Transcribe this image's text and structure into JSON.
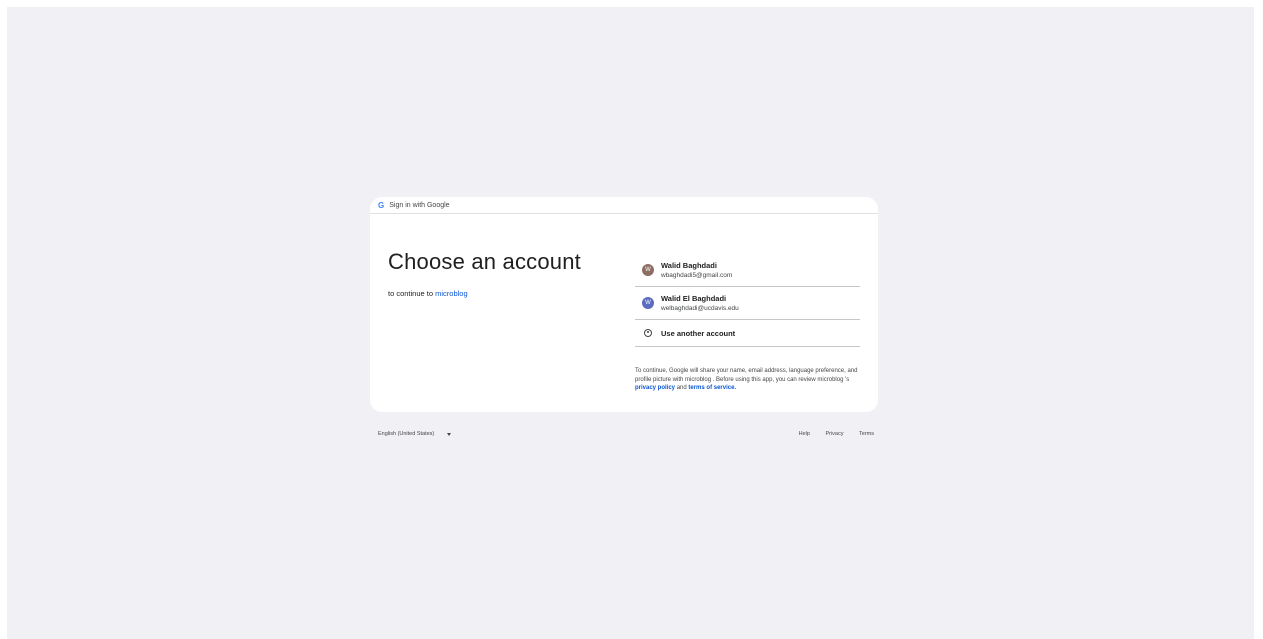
{
  "header": {
    "logo": "G",
    "label": "Sign in with Google"
  },
  "main": {
    "title": "Choose an account",
    "subtitle_prefix": "to continue to ",
    "app_name": "microblog"
  },
  "accounts": [
    {
      "initial": "W",
      "name": "Walid Baghdadi",
      "email": "wbaghdadi5@gmail.com",
      "avatar_color": "#8d6e63"
    },
    {
      "initial": "W",
      "name": "Walid El Baghdadi",
      "email": "welbaghdadi@ucdavis.edu",
      "avatar_color": "#5c6bc0"
    }
  ],
  "use_another": "Use another account",
  "notice": {
    "part1": "To continue, Google will share your name, email address, language preference, and profile picture with microblog . Before using this app, you can review microblog 's ",
    "privacy": "privacy policy",
    "and": " and ",
    "terms": "terms of service",
    "end": "."
  },
  "footer": {
    "language": "English (United States)",
    "help": "Help",
    "privacy": "Privacy",
    "terms": "Terms"
  },
  "colors": {
    "background": "#f0f0f5",
    "link": "#0b57d0",
    "card": "#ffffff"
  }
}
